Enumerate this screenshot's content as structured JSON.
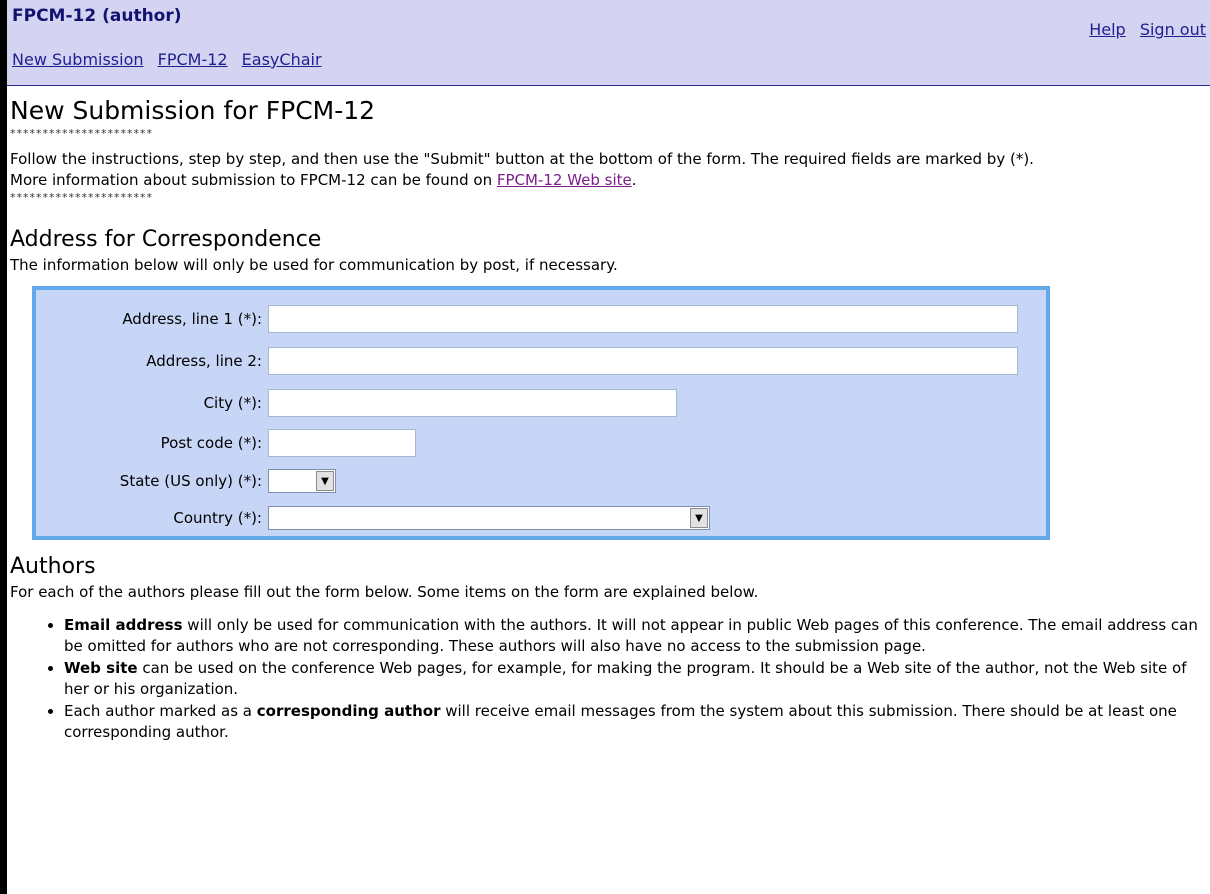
{
  "header": {
    "title": "FPCM-12 (author)",
    "nav": [
      "New Submission",
      "FPCM-12",
      "EasyChair"
    ],
    "right_links": [
      "Help",
      "Sign out"
    ]
  },
  "page": {
    "title": "New Submission for FPCM-12",
    "stars": "**********************",
    "instruction_1": "Follow the instructions, step by step, and then use the \"Submit\" button at the bottom of the form. The required fields are marked by (*).",
    "instruction_2_prefix": "More information about submission to FPCM-12 can be found on ",
    "instruction_2_link": "FPCM-12 Web site",
    "instruction_2_suffix": "."
  },
  "address": {
    "heading": "Address for Correspondence",
    "note": "The information below will only be used for communication by post, if necessary.",
    "fields": {
      "line1_label": "Address, line 1 (*):",
      "line2_label": "Address, line 2:",
      "city_label": "City (*):",
      "postcode_label": "Post code (*):",
      "state_label": "State (US only) (*):",
      "country_label": "Country (*):"
    },
    "values": {
      "line1": "",
      "line2": "",
      "city": "",
      "postcode": "",
      "state": "",
      "country": ""
    }
  },
  "authors": {
    "heading": "Authors",
    "intro": "For each of the authors please fill out the form below. Some items on the form are explained below.",
    "bullets": [
      {
        "bold": "Email address",
        "text": " will only be used for communication with the authors. It will not appear in public Web pages of this conference. The email address can be omitted for authors who are not corresponding. These authors will also have no access to the submission page."
      },
      {
        "bold": "Web site",
        "text": " can be used on the conference Web pages, for example, for making the program. It should be a Web site of the author, not the Web site of her or his organization."
      },
      {
        "prefix": "Each author marked as a ",
        "bold": "corresponding author",
        "text": " will receive email messages from the system about this submission. There should be at least one corresponding author."
      }
    ]
  }
}
